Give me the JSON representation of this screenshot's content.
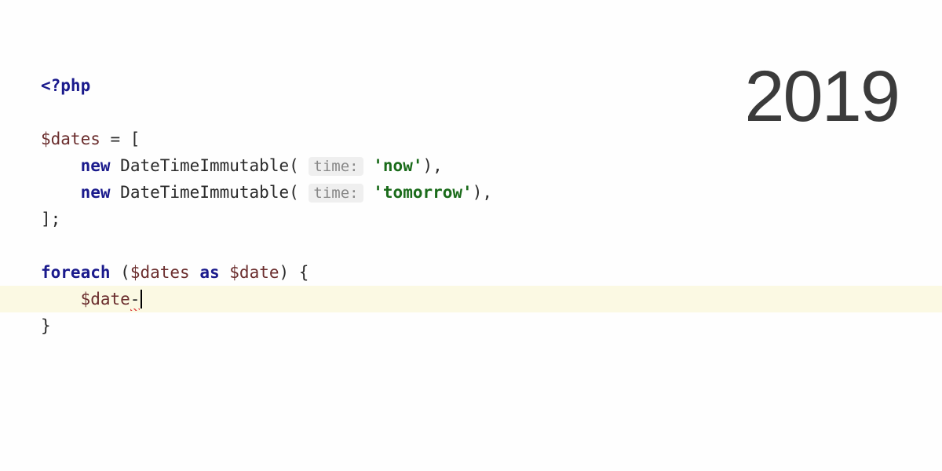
{
  "year": "2019",
  "code": {
    "php_open": "<?php",
    "var_dates": "$dates",
    "equals": " = [",
    "new_kw": "new",
    "class_dti": "DateTimeImmutable",
    "param_hint": "time:",
    "str_now": "'now'",
    "str_tomorrow": "'tomorrow'",
    "close_array": "];",
    "foreach_kw": "foreach",
    "as_kw": "as",
    "var_date": "$date",
    "arrow_partial": "-",
    "brace_open": "{",
    "brace_close": "}"
  }
}
